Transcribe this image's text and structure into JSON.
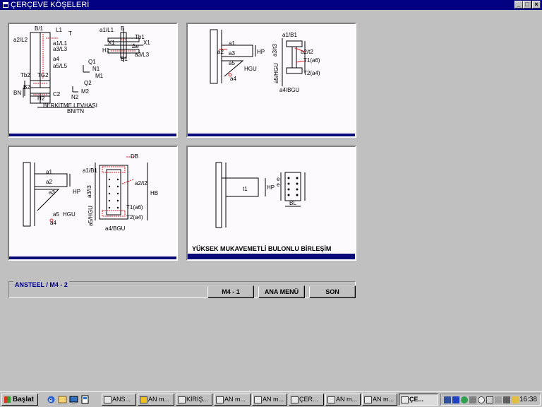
{
  "window": {
    "title": "ÇERÇEVE KÖŞELERİ",
    "min": "_",
    "max": "□",
    "close": "×"
  },
  "panels": [
    {
      "name": "frame-corner-detail",
      "labels": [
        "B/1",
        "L1",
        "T",
        "a2/L2",
        "a1/L1",
        "a3/L3",
        "a4",
        "a5/L5",
        "Tb2",
        "TG2",
        "B2",
        "BN",
        "H2",
        "C2",
        "BERKİTME LEVHASI",
        "BN/TN",
        "a1/L1",
        "B",
        "Tb1",
        "X1",
        "X1",
        "H1",
        "Δe",
        "a3/L3",
        "B1",
        "Q1",
        "N1",
        "M1",
        "Q2",
        "M2",
        "N2"
      ]
    },
    {
      "name": "haunch-section-1",
      "labels": [
        "a1",
        "a2",
        "a3",
        "a5",
        "a4",
        "HP",
        "HGU",
        "a1/B1",
        "a3/t3",
        "a2/t2",
        "T1(a6)",
        "T2(a4)",
        "a5/HGU",
        "a4/BGU"
      ]
    },
    {
      "name": "haunch-section-2",
      "labels": [
        "a1",
        "a2",
        "a3",
        "a5",
        "a4",
        "HP",
        "HGU",
        "DB",
        "a1/B1",
        "a3/t3",
        "a2/t2",
        "HB",
        "T1(a6)",
        "T2(a4)",
        "a5/HGU",
        "a4/BGU"
      ]
    },
    {
      "name": "bolted-connection",
      "labels": [
        "HP",
        "BL",
        "e",
        "e",
        "t1"
      ],
      "caption": "YÜKSEK MUKAVEMETLİ BULONLU BİRLEŞİM"
    }
  ],
  "status": {
    "text": "ANSTEEL   / M4 - 2"
  },
  "buttons": {
    "m4_1": "M4 - 1",
    "ana_menu": "ANA MENÜ",
    "son": "SON"
  },
  "taskbar": {
    "start": "Başlat",
    "tasks": [
      "ANS...",
      "AN m...",
      "KİRİŞ...",
      "AN m...",
      "AN m...",
      "ÇER...",
      "AN m...",
      "AN m...",
      "ÇE..."
    ],
    "clock": "16:38"
  },
  "colors": {
    "titlebar": "#000080",
    "panel_bg": "#fdfaff",
    "accent_red": "#e02020",
    "band": "#0a0a78"
  }
}
